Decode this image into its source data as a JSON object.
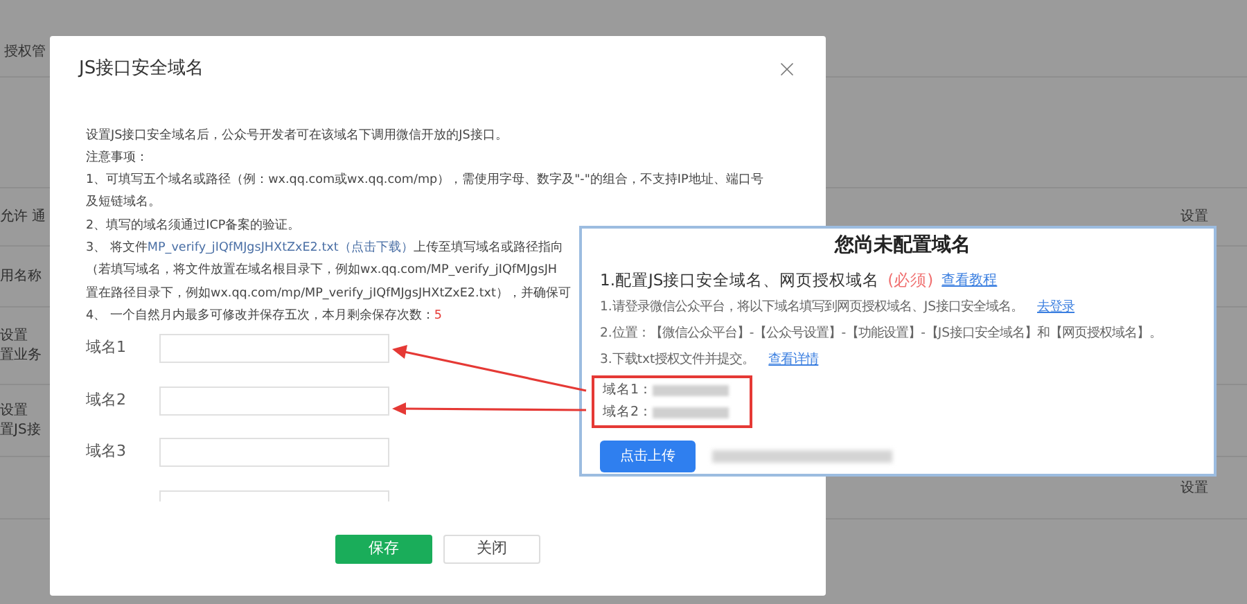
{
  "page": {
    "header_tab": "授权管",
    "rows": [
      {
        "left": [
          "允许 通"
        ],
        "right": "设置"
      },
      {
        "left": [
          "用名称"
        ]
      },
      {
        "left": [
          "设置",
          "置业务"
        ]
      },
      {
        "left": [
          "设置",
          "置JS接"
        ]
      },
      {
        "left": [],
        "right": "设置"
      }
    ]
  },
  "dialog": {
    "title": "JS接口安全域名",
    "lines": [
      [
        {
          "kind": "plain",
          "text": "设置JS接口安全域名后，公众号开发者可在该域名下调用微信开放的JS接口。"
        }
      ],
      [
        {
          "kind": "plain",
          "text": "注意事项："
        }
      ],
      [
        {
          "kind": "plain",
          "text": "1、可填写五个域名或路径（例：wx.qq.com或wx.qq.com/mp），需使用字母、数字及\"-\"的组合，不支持IP地址、端口号"
        }
      ],
      [
        {
          "kind": "plain",
          "text": "及短链域名。"
        }
      ],
      [
        {
          "kind": "plain",
          "text": "2、填写的域名须通过ICP备案的验证。"
        }
      ],
      [
        {
          "kind": "plain",
          "text": "3、 将文件"
        },
        {
          "kind": "link",
          "text": "MP_verify_jIQfMJgsJHXtZxE2.txt（点击下载）"
        },
        {
          "kind": "plain",
          "text": "上传至填写域名或路径指向"
        }
      ],
      [
        {
          "kind": "plain",
          "text": "（若填写域名，将文件放置在域名根目录下，例如wx.qq.com/MP_verify_jIQfMJgsJH"
        }
      ],
      [
        {
          "kind": "plain",
          "text": "置在路径目录下，例如wx.qq.com/mp/MP_verify_jIQfMJgsJHXtZxE2.txt），并确保可"
        }
      ],
      [
        {
          "kind": "plain",
          "text": "4、 一个自然月内最多可修改并保存五次，本月剩余保存次数："
        },
        {
          "kind": "highlight",
          "text": "5"
        }
      ]
    ],
    "fields": [
      {
        "kind": "field",
        "label": "域名1"
      },
      {
        "kind": "field",
        "label": "域名2"
      },
      {
        "kind": "field",
        "label": "域名3"
      },
      {
        "kind": "cut_off"
      }
    ],
    "buttons": [
      {
        "kind": "primary",
        "label": "保存"
      },
      {
        "kind": "default",
        "label": "关闭"
      }
    ]
  },
  "callout": {
    "title": "您尚未配置域名",
    "heading": {
      "text": "1.配置JS接口安全域名、网页授权域名",
      "tag": "(必须)",
      "link": "查看教程"
    },
    "steps": [
      {
        "text": "1.请登录微信公众平台，将以下域名填写到网页授权域名、JS接口安全域名。",
        "link": "去登录"
      },
      {
        "text": "2.位置：【微信公众平台】-【公众号设置】-【功能设置】-【JS接口安全域名】和【网页授权域名】。"
      },
      {
        "text": "3.下载txt授权文件并提交。",
        "link": "查看详情"
      }
    ],
    "domains": [
      {
        "label": "域名1：",
        "value_redacted": true
      },
      {
        "label": "域名2：",
        "value_redacted": true
      }
    ],
    "upload_button": "点击上传",
    "status_redacted": true
  }
}
